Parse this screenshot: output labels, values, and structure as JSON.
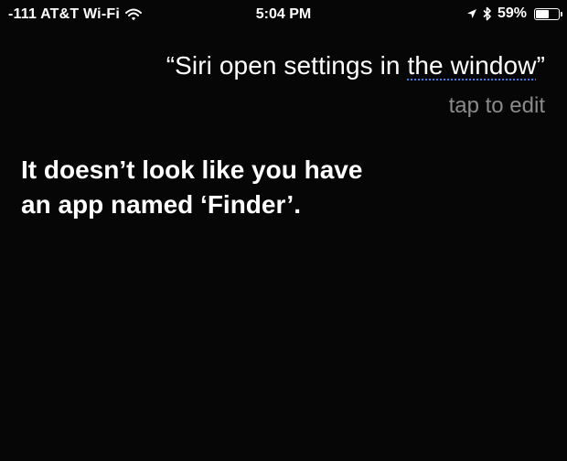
{
  "status_bar": {
    "carrier": "-111 AT&T Wi-Fi",
    "time": "5:04 PM",
    "battery_percent_label": "59%",
    "battery_level": 0.59,
    "icons": [
      "wifi-icon",
      "location-arrow-icon",
      "bluetooth-icon",
      "battery-icon"
    ]
  },
  "siri": {
    "query_open_quote": "“",
    "query_text_plain": "Siri open settings in ",
    "query_text_flagged": "the window",
    "query_close_quote": "”",
    "tap_to_edit": "tap to edit",
    "response_line_1": "It doesn’t look like you have",
    "response_line_2": "an app named ‘Finder’."
  },
  "colors": {
    "background": "#060606",
    "text": "#ffffff",
    "secondary_text": "#8a8a8a",
    "spellcheck_underline": "#3a7cf0"
  }
}
